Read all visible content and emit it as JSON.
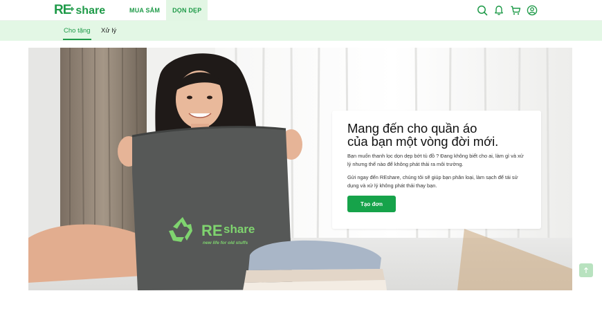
{
  "brand": {
    "logo_re": "RE",
    "logo_share": "share",
    "color": "#1e9a48"
  },
  "topnav": {
    "items": [
      {
        "label": "MUA SẮM"
      },
      {
        "label": "DỌN DẸP"
      }
    ]
  },
  "icons": [
    "search-icon",
    "bell-icon",
    "cart-icon",
    "user-icon"
  ],
  "subnav": {
    "tabs": [
      {
        "label": "Cho tặng"
      },
      {
        "label": "Xử lý"
      }
    ]
  },
  "hero": {
    "title_line1": "Mang đến cho quần áo",
    "title_line2": "của bạn một vòng đời mới.",
    "para1": "Bạn muốn thanh lọc dọn dẹp bớt tủ đồ ? Đang không biết cho ai, làm gì và xử lý nhưng thế nào để không phát thải ra môi trường.",
    "para2": "Gửi ngay đến REshare, chúng tôi sẽ giúp bạn phân loại, làm sạch để tái sử dụng và xử lý không phát thải thay bạn.",
    "cta_label": "Tạo đơn",
    "bag_logo_re": "RE",
    "bag_logo_share": "share",
    "bag_tagline": "new life for old stuffs"
  },
  "colors": {
    "accent": "#1e9a48",
    "button": "#16a34a",
    "subnav_bg": "#e3f7e5"
  }
}
